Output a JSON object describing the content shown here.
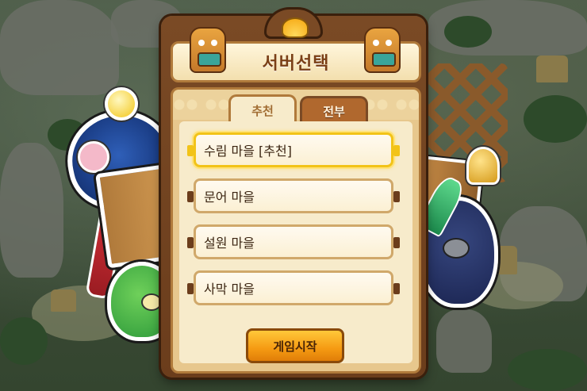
{
  "dialog": {
    "title": "서버선택",
    "tabs": [
      {
        "label": "추천",
        "active": true
      },
      {
        "label": "전부",
        "active": false
      }
    ],
    "servers": [
      {
        "name": "수림 마을 [추천]",
        "selected": true
      },
      {
        "name": "문어 마을",
        "selected": false
      },
      {
        "name": "설원 마을",
        "selected": false
      },
      {
        "name": "사막 마을",
        "selected": false
      }
    ],
    "start_button": "게임시작"
  },
  "colors": {
    "frame": "#7a4a25",
    "panel": "#e7c78d",
    "selected_border": "#f2c318",
    "button": "#f59a12",
    "title_text": "#7a3f16"
  },
  "icons": {
    "crest": "shell-icon",
    "left_decoration": "totem-mask-icon",
    "right_decoration": "totem-mask-icon"
  }
}
